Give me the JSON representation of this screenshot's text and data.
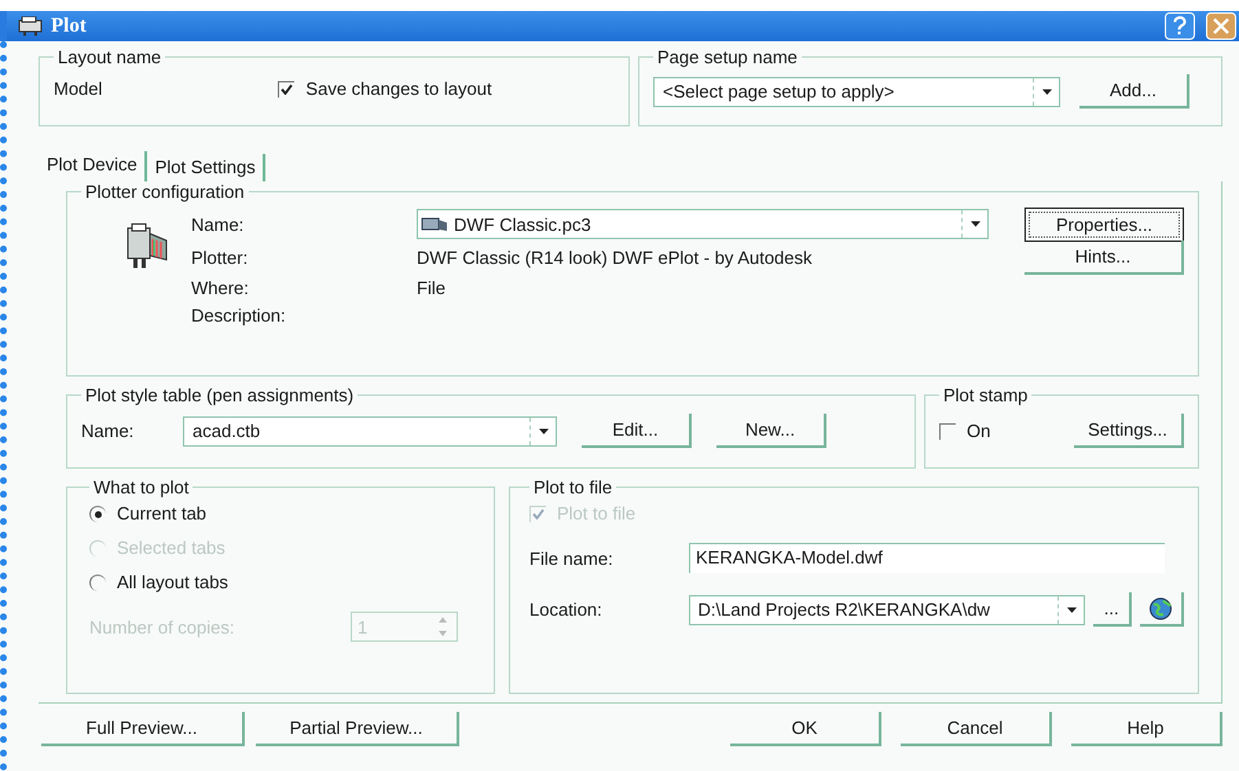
{
  "window": {
    "title": "Plot"
  },
  "layout_name": {
    "title": "Layout name",
    "value": "Model",
    "save_changes": {
      "label": "Save changes to layout",
      "checked": true
    }
  },
  "page_setup_name": {
    "title": "Page setup name",
    "select": "<Select page setup to apply>",
    "button": "Add..."
  },
  "tabs": [
    {
      "label": "Plot Device",
      "selected": true
    },
    {
      "label": "Plot Settings",
      "selected": false
    }
  ],
  "plotter_configuration": {
    "title": "Plotter configuration",
    "fields": [
      {
        "kind": "select",
        "label": "Name:",
        "value": "DWF Classic.pc3"
      },
      {
        "kind": "text",
        "label": "Plotter:",
        "value": "DWF Classic (R14 look) DWF ePlot - by Autodesk"
      },
      {
        "kind": "text",
        "label": "Where:",
        "value": "File"
      },
      {
        "kind": "text",
        "label": "Description:"
      }
    ],
    "buttons": [
      {
        "label": "Properties...",
        "focused": true
      },
      {
        "label": "Hints...",
        "focused": false
      }
    ]
  },
  "plot_style_table": {
    "title": "Plot style table (pen assignments)",
    "label": "Name:",
    "value": "acad.ctb",
    "buttons": [
      "Edit...",
      "New..."
    ]
  },
  "plot_stamp": {
    "title": "Plot stamp",
    "on": {
      "label": "On",
      "checked": false
    },
    "button": "Settings..."
  },
  "what_to_plot": {
    "title": "What to plot",
    "options": [
      {
        "label": "Current tab",
        "selected": true,
        "disabled": false
      },
      {
        "label": "Selected tabs",
        "selected": false,
        "disabled": true
      },
      {
        "label": "All layout tabs",
        "selected": false,
        "disabled": false
      }
    ],
    "copies": {
      "label": "Number of copies:",
      "value": "1",
      "disabled": true
    }
  },
  "plot_to_file": {
    "title": "Plot to file",
    "plot_to_file": {
      "label": "Plot to file",
      "checked": true,
      "disabled": true
    },
    "file_name": {
      "label": "File name:",
      "value": "KERANGKA-Model.dwf"
    },
    "location": {
      "label": "Location:",
      "value": "D:\\Land Projects R2\\KERANGKA\\dw",
      "browse": "..."
    }
  },
  "preview_buttons": [
    "Full Preview...",
    "Partial Preview..."
  ],
  "dialog_buttons": [
    "OK",
    "Cancel",
    "Help"
  ]
}
